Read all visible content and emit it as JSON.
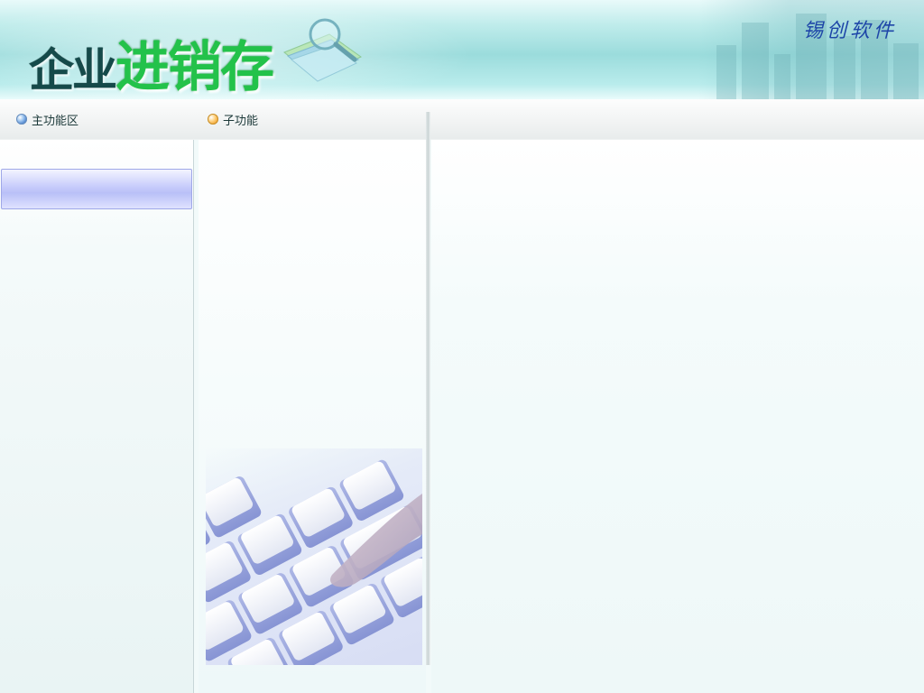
{
  "header": {
    "title_part1": "企业",
    "title_part2": "进销存",
    "brand": "锡创软件"
  },
  "nav": {
    "main_area_label": "主功能区",
    "sub_function_label": "子功能"
  },
  "colors": {
    "title_dark": "#154a4a",
    "title_green": "#23c24a",
    "brand_blue": "#1e46a8",
    "selected_item_bg": "#c6cbfb"
  }
}
